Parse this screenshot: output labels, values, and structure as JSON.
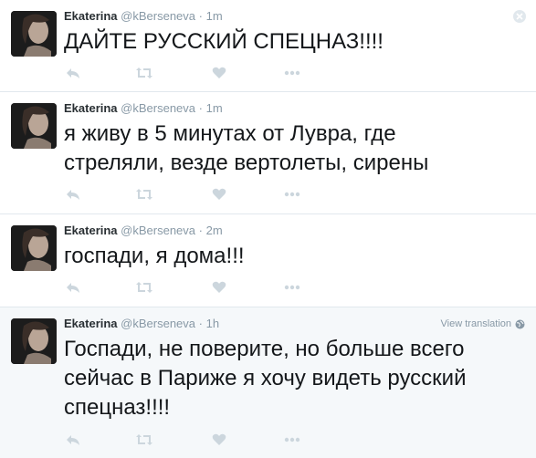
{
  "tweets": [
    {
      "name": "Ekaterina",
      "handle": "@kBerseneva",
      "separator": "·",
      "time": "1m",
      "text": "ДАЙТЕ РУССКИЙ СПЕЦНАЗ!!!!"
    },
    {
      "name": "Ekaterina",
      "handle": "@kBerseneva",
      "separator": "·",
      "time": "1m",
      "text": "я живу в 5 минутах от Лувра, где\nстреляли, везде вертолеты, сирены"
    },
    {
      "name": "Ekaterina",
      "handle": "@kBerseneva",
      "separator": "·",
      "time": "2m",
      "text": "госпади, я дома!!!"
    },
    {
      "name": "Ekaterina",
      "handle": "@kBerseneva",
      "separator": "·",
      "time": "1h",
      "view_translation": "View translation",
      "text": "Госпади, не поверите, но больше всего\nсейчас в Париже я хочу видеть русский\nспецназ!!!!"
    }
  ],
  "icons": {
    "reply": "reply-icon",
    "retweet": "retweet-icon",
    "favorite": "heart-icon",
    "more": "more-icon",
    "globe": "globe-icon",
    "close": "close-icon"
  },
  "colors": {
    "text": "#14171a",
    "muted": "#8899a6",
    "icon": "#ccd6dd",
    "divider": "#e1e8ed",
    "highlight_bg": "#f5f8fa"
  }
}
